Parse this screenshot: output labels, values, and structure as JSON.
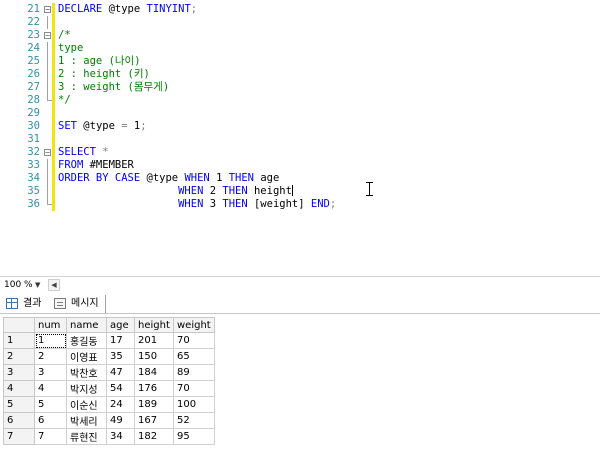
{
  "editor": {
    "lines": [
      {
        "n": "21",
        "fold": "minus",
        "tokens": [
          [
            "kw",
            "DECLARE "
          ],
          [
            "bk",
            "@type "
          ],
          [
            "kw",
            "TINYINT"
          ],
          [
            "gr",
            ";"
          ]
        ]
      },
      {
        "n": "22",
        "fold": "line",
        "tokens": []
      },
      {
        "n": "23",
        "fold": "minus",
        "tokens": [
          [
            "cm",
            "/*"
          ]
        ]
      },
      {
        "n": "24",
        "fold": "line",
        "tokens": [
          [
            "cm",
            "type"
          ]
        ]
      },
      {
        "n": "25",
        "fold": "line",
        "tokens": [
          [
            "cm",
            "1 : age (나이)"
          ]
        ]
      },
      {
        "n": "26",
        "fold": "line",
        "tokens": [
          [
            "cm",
            "2 : height (키)"
          ]
        ]
      },
      {
        "n": "27",
        "fold": "line",
        "tokens": [
          [
            "cm",
            "3 : weight (몸무게)"
          ]
        ]
      },
      {
        "n": "28",
        "fold": "end",
        "tokens": [
          [
            "cm",
            "*/"
          ]
        ]
      },
      {
        "n": "29",
        "fold": "none",
        "tokens": []
      },
      {
        "n": "30",
        "fold": "none",
        "tokens": [
          [
            "kw",
            "SET "
          ],
          [
            "bk",
            "@type "
          ],
          [
            "gr",
            "= "
          ],
          [
            "bk",
            "1"
          ],
          [
            "gr",
            ";"
          ]
        ]
      },
      {
        "n": "31",
        "fold": "none",
        "tokens": []
      },
      {
        "n": "32",
        "fold": "minus",
        "tokens": [
          [
            "kw",
            "SELECT "
          ],
          [
            "gr",
            "*"
          ]
        ]
      },
      {
        "n": "33",
        "fold": "line",
        "tokens": [
          [
            "kw",
            "FROM "
          ],
          [
            "bk",
            "#MEMBER"
          ]
        ]
      },
      {
        "n": "34",
        "fold": "line",
        "tokens": [
          [
            "kw",
            "ORDER BY CASE "
          ],
          [
            "bk",
            "@type "
          ],
          [
            "kw",
            "WHEN "
          ],
          [
            "bk",
            "1 "
          ],
          [
            "kw",
            "THEN "
          ],
          [
            "bk",
            "age"
          ]
        ]
      },
      {
        "n": "35",
        "fold": "line",
        "tokens": [
          [
            "bk",
            "                   "
          ],
          [
            "kw",
            "WHEN "
          ],
          [
            "bk",
            "2 "
          ],
          [
            "kw",
            "THEN "
          ],
          [
            "bk",
            "height"
          ]
        ],
        "caret": true
      },
      {
        "n": "36",
        "fold": "end",
        "tokens": [
          [
            "bk",
            "                   "
          ],
          [
            "kw",
            "WHEN "
          ],
          [
            "bk",
            "3 "
          ],
          [
            "kw",
            "THEN "
          ],
          [
            "bk",
            "[weight] "
          ],
          [
            "kw",
            "END"
          ],
          [
            "gr",
            ";"
          ]
        ]
      }
    ]
  },
  "zoom": {
    "value": "100 %"
  },
  "tabs": {
    "results": "결과",
    "messages": "메시지"
  },
  "results": {
    "columns": [
      "num",
      "name",
      "age",
      "height",
      "weight"
    ],
    "rows": [
      {
        "row": "1",
        "cells": [
          "1",
          "홍길동",
          "17",
          "201",
          "70"
        ]
      },
      {
        "row": "2",
        "cells": [
          "2",
          "이영표",
          "35",
          "150",
          "65"
        ]
      },
      {
        "row": "3",
        "cells": [
          "3",
          "박찬호",
          "47",
          "184",
          "89"
        ]
      },
      {
        "row": "4",
        "cells": [
          "4",
          "박지성",
          "54",
          "176",
          "70"
        ]
      },
      {
        "row": "5",
        "cells": [
          "5",
          "이순신",
          "24",
          "189",
          "100"
        ]
      },
      {
        "row": "6",
        "cells": [
          "6",
          "박세리",
          "49",
          "167",
          "52"
        ]
      },
      {
        "row": "7",
        "cells": [
          "7",
          "류현진",
          "34",
          "182",
          "95"
        ]
      }
    ]
  },
  "colors": {
    "keyword": "#0000ff",
    "comment": "#008000",
    "operator": "#808080",
    "line_number": "#2b91af",
    "change_marker": "#f0e60a"
  }
}
